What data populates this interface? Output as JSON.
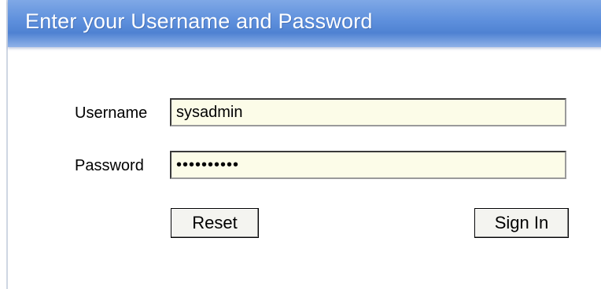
{
  "header": {
    "title": "Enter your Username and Password"
  },
  "form": {
    "username_label": "Username",
    "username_value": "sysadmin",
    "password_label": "Password",
    "password_value": "••••••••••"
  },
  "buttons": {
    "reset_label": "Reset",
    "signin_label": "Sign In"
  },
  "colors": {
    "header_blue": "#5d8fdc",
    "field_background": "#fcfce8"
  }
}
